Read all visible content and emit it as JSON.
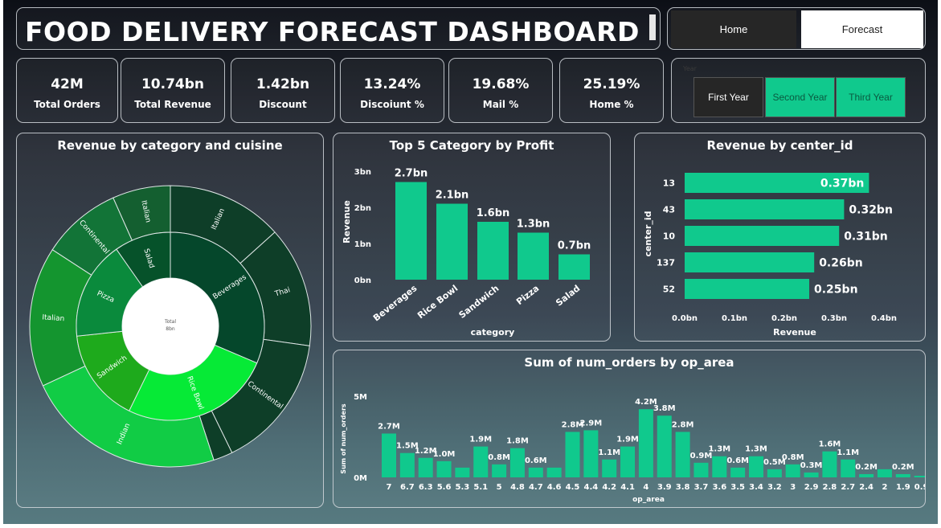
{
  "header": {
    "title": "FOOD DELIVERY FORECAST DASHBOARD"
  },
  "nav": {
    "home": "Home",
    "forecast": "Forecast"
  },
  "kpis": [
    {
      "value": "42M",
      "label": "Total Orders"
    },
    {
      "value": "10.74bn",
      "label": "Total Revenue"
    },
    {
      "value": "1.42bn",
      "label": "Discount"
    },
    {
      "value": "13.24%",
      "label": "Discoiunt %"
    },
    {
      "value": "19.68%",
      "label": "Mail %"
    },
    {
      "value": "25.19%",
      "label": "Home %"
    }
  ],
  "year_filter": {
    "label": "Year",
    "options": [
      "First Year",
      "Second Year",
      "Third Year"
    ],
    "selected": [
      "Second Year",
      "Third Year"
    ]
  },
  "colors": {
    "accent": "#10c98d",
    "dark_button": "#262626"
  },
  "chart_data": [
    {
      "type": "sunburst",
      "title": "Revenue by category and cuisine",
      "center_label": "Total",
      "center_value": "8bn",
      "inner": [
        {
          "name": "Beverages",
          "color": "#05472b"
        },
        {
          "name": "Rice Bowl",
          "color": "#06ea36"
        },
        {
          "name": "Sandwich",
          "color": "#1eaa1c"
        },
        {
          "name": "Pizza",
          "color": "#0a8a3c"
        },
        {
          "name": "Salad",
          "color": "#06522a"
        }
      ],
      "outer": [
        {
          "name": "Italian",
          "color": "#0e3e28"
        },
        {
          "name": "Thai",
          "color": "#0e3e28"
        },
        {
          "name": "Continental",
          "color": "#0e3e28"
        },
        {
          "name": "",
          "color": "#0e3e28"
        },
        {
          "name": "Indian",
          "color": "#11cc45"
        },
        {
          "name": "Italian",
          "color": "#14952f"
        },
        {
          "name": "Continental",
          "color": "#127437"
        },
        {
          "name": "Italian",
          "color": "#145f30"
        }
      ]
    },
    {
      "type": "bar",
      "title": "Top 5 Category by Profit",
      "categories": [
        "Beverages",
        "Rice Bowl",
        "Sandwich",
        "Pizza",
        "Salad"
      ],
      "values": [
        2.7,
        2.1,
        1.6,
        1.3,
        0.7
      ],
      "labels": [
        "2.7bn",
        "2.1bn",
        "1.6bn",
        "1.3bn",
        "0.7bn"
      ],
      "xlabel": "category",
      "ylabel": "Revenue",
      "yticks": [
        "0bn",
        "1bn",
        "2bn",
        "3bn"
      ],
      "ylim": [
        0,
        3
      ]
    },
    {
      "type": "bar",
      "orientation": "horizontal",
      "title": "Revenue by center_id",
      "categories": [
        "13",
        "43",
        "10",
        "137",
        "52"
      ],
      "values": [
        0.37,
        0.32,
        0.31,
        0.26,
        0.25
      ],
      "labels": [
        "0.37bn",
        "0.32bn",
        "0.31bn",
        "0.26bn",
        "0.25bn"
      ],
      "xlabel": "Revenue",
      "ylabel": "center_id",
      "xticks": [
        "0.0bn",
        "0.1bn",
        "0.2bn",
        "0.3bn",
        "0.4bn"
      ],
      "xlim": [
        0,
        0.4
      ]
    },
    {
      "type": "bar",
      "title": "Sum of num_orders by op_area",
      "categories": [
        "7",
        "6.7",
        "6.3",
        "5.6",
        "5.3",
        "5.1",
        "5",
        "4.8",
        "4.7",
        "4.6",
        "4.5",
        "4.4",
        "4.2",
        "4.1",
        "4",
        "3.9",
        "3.8",
        "3.7",
        "3.6",
        "3.5",
        "3.4",
        "3.2",
        "3",
        "2.9",
        "2.8",
        "2.7",
        "2.4",
        "2",
        "1.9",
        "0.9"
      ],
      "values": [
        2.7,
        1.5,
        1.2,
        1.0,
        0.6,
        1.9,
        0.8,
        1.8,
        0.6,
        0.6,
        2.8,
        2.9,
        1.1,
        1.9,
        4.2,
        3.8,
        2.8,
        0.9,
        1.3,
        0.6,
        1.3,
        0.5,
        0.8,
        0.3,
        1.6,
        1.1,
        0.2,
        0.5,
        0.2,
        0.1
      ],
      "labels": [
        "2.7M",
        "1.5M",
        "1.2M",
        "1.0M",
        "",
        "1.9M",
        "0.8M",
        "1.8M",
        "0.6M",
        "",
        "2.8M",
        "2.9M",
        "1.1M",
        "1.9M",
        "4.2M",
        "3.8M",
        "2.8M",
        "0.9M",
        "1.3M",
        "0.6M",
        "1.3M",
        "0.5M",
        "0.8M",
        "0.3M",
        "1.6M",
        "1.1M",
        "0.2M",
        "",
        "0.2M",
        ""
      ],
      "xlabel": "op_area",
      "ylabel": "Sum of num_orders",
      "yticks": [
        "0M",
        "5M"
      ],
      "ylim": [
        0,
        5
      ]
    }
  ]
}
